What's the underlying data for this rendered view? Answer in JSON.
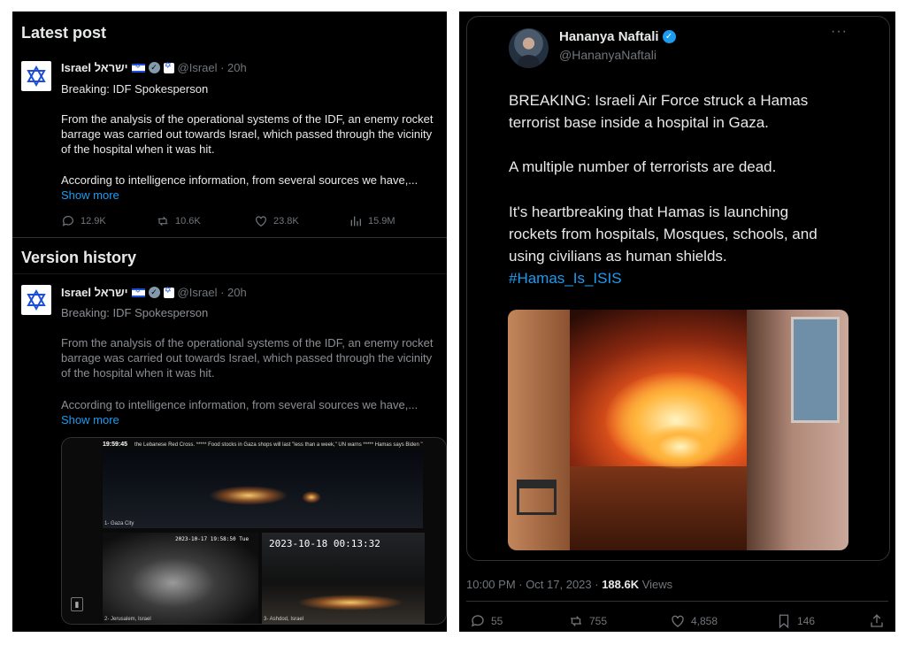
{
  "left_panel": {
    "latest_title": "Latest post",
    "version_title": "Version history",
    "posts": [
      {
        "name": "Israel ישראל",
        "handle": "@Israel · 20h",
        "headline": "Breaking: IDF Spokesperson",
        "lines": [
          "From the analysis of the operational systems of the IDF, an enemy rocket",
          "barrage was carried out towards Israel, which passed through the vicinity",
          "of the hospital when it was hit."
        ],
        "line4": "According to intelligence information, from several sources we have,...",
        "show_more": "Show more",
        "replies": "12.9K",
        "reposts": "10.6K",
        "likes": "23.8K",
        "views": "15.9M"
      },
      {
        "name": "Israel ישראל",
        "handle": "@Israel · 20h",
        "headline": "Breaking: IDF Spokesperson",
        "lines": [
          "From the analysis of the operational systems of the IDF, an enemy rocket",
          "barrage was carried out towards Israel, which passed through the vicinity",
          "of the hospital when it was hit."
        ],
        "line4": "According to intelligence information, from several sources we have,...",
        "show_more": "Show more"
      }
    ],
    "video": {
      "time": "19:59:45",
      "ticker": "the Lebanese Red Cross. ***** Food stocks in Gaza shops will last \"less than a week,\" UN warns ***** Hamas says Biden \"",
      "cam1": "1- Gaza City",
      "cam2": "2- Jerusalem, Israel",
      "cam3": "3- Ashdod, Israel",
      "stamp_small": "2023-10-17 19:58:50 Tue",
      "stamp_big": "2023-10-18 00:13:32"
    }
  },
  "right_panel": {
    "name": "Hananya Naftali",
    "handle": "@HananyaNaftali",
    "more": "···",
    "p1": [
      "BREAKING: Israeli Air Force struck a Hamas",
      "terrorist base inside a hospital in Gaza."
    ],
    "p2": "A multiple number of terrorists are dead.",
    "p3": [
      "It's heartbreaking that Hamas is launching",
      "rockets from hospitals, Mosques, schools, and",
      "using civilians as human shields."
    ],
    "hashtag": "#Hamas_Is_ISIS",
    "time": "10:00 PM · Oct 17, 2023 · ",
    "views_count": "188.6K",
    "views_label": " Views",
    "replies": "55",
    "reposts": "755",
    "likes": "4,858",
    "bookmarks": "146"
  },
  "colors": {
    "accent": "#1d9bf0",
    "background": "#000000",
    "muted": "#71767b"
  }
}
